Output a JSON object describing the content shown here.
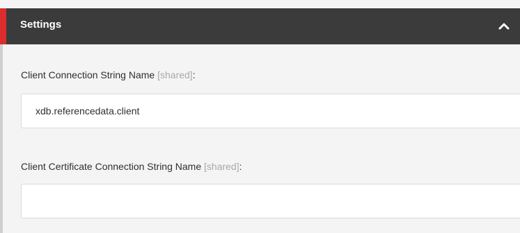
{
  "section": {
    "title": "Settings",
    "toggle_icon": "chevron-up-icon"
  },
  "fields": [
    {
      "label": "Client Connection String Name",
      "shared_tag": "[shared]",
      "colon": ":",
      "value": "xdb.referencedata.client",
      "placeholder": ""
    },
    {
      "label": "Client Certificate Connection String Name",
      "shared_tag": "[shared]",
      "colon": ":",
      "value": "",
      "placeholder": ""
    }
  ],
  "colors": {
    "header_background": "#3b3b3b",
    "header_accent": "#dc2d2d",
    "shared_tag": "#a8a8a8"
  }
}
